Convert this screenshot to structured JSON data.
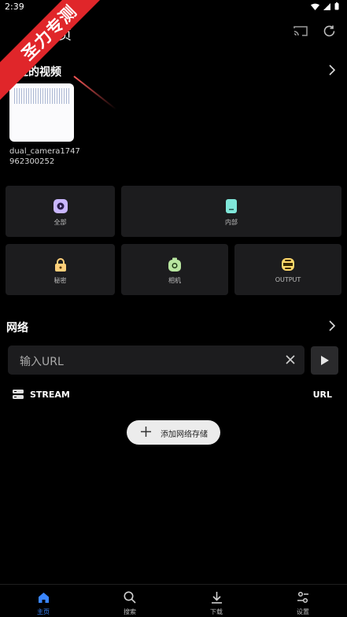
{
  "status_bar": {
    "time": "2:39"
  },
  "watermark": {
    "text": "圣力专测"
  },
  "app_bar": {
    "title": "主页"
  },
  "recent": {
    "label": "最近的视频",
    "video": {
      "name": "dual_camera1747962300252"
    }
  },
  "tiles": [
    {
      "label": "全部",
      "icon": "play-icon",
      "color": "#c9b6ff"
    },
    {
      "label": "内部",
      "icon": "phone-icon",
      "color": "#7fe6d9"
    },
    {
      "label": "秘密",
      "icon": "lock-icon",
      "color": "#ffcf7a"
    },
    {
      "label": "相机",
      "icon": "camera-icon",
      "color": "#b8e6a0"
    },
    {
      "label": "OUTPUT",
      "icon": "folder-icon",
      "color": "#ffd86b"
    }
  ],
  "network": {
    "label": "网络",
    "url_placeholder": "输入URL",
    "stream_label": "STREAM",
    "url_label": "URL",
    "add_storage_label": "添加网络存储"
  },
  "bottom_nav": [
    {
      "label": "主页",
      "icon": "home-icon",
      "active": true
    },
    {
      "label": "搜索",
      "icon": "search-icon",
      "active": false
    },
    {
      "label": "下载",
      "icon": "download-icon",
      "active": false
    },
    {
      "label": "设置",
      "icon": "settings-icon",
      "active": false
    }
  ],
  "colors": {
    "accent": "#3a86ff",
    "tile_bg": "#1c1c1e",
    "watermark": "#e0262a"
  }
}
